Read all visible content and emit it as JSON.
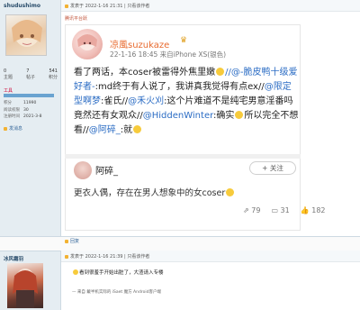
{
  "post1": {
    "username": "shudushimo",
    "stats": [
      {
        "value": "0",
        "label": ""
      },
      {
        "value": "7",
        "label": ""
      },
      {
        "value": "541",
        "label": ""
      },
      {
        "value": "主题",
        "label": ""
      },
      {
        "value": "帖子",
        "label": ""
      },
      {
        "value": "积分",
        "label": ""
      }
    ],
    "level_label": "工具",
    "info": [
      {
        "key": "积分",
        "val": "11990"
      },
      {
        "key": "阅读权限",
        "val": "30"
      },
      {
        "key": "注册时间",
        "val": "2021-3-8"
      }
    ],
    "msg_btn": "发消息",
    "header": "发表于 2022-1-16 21:31  |  只看该作者",
    "title_line": "腾讯平台跃",
    "card": {
      "user": "凉風suzukaze",
      "meta": "22-1-16 18:45 来自iPhone XS(银色)",
      "text_parts": [
        {
          "t": "看了两话，本coser被雷得外焦里嫩",
          "at": false
        },
        {
          "t": "//@-脆皮鸭十级爱好者-",
          "at": true
        },
        {
          "t": ":md终于有人说了，我讲真我觉得有点ex//",
          "at": false
        },
        {
          "t": "@限定型啊梦",
          "at": true
        },
        {
          "t": ":雀氏//",
          "at": false
        },
        {
          "t": "@禾火刈",
          "at": true
        },
        {
          "t": ":这个片难道不是纯宅男意淫番吗竟然还有女观众//",
          "at": false
        },
        {
          "t": "@HiddenWinter",
          "at": true
        },
        {
          "t": ":确实",
          "at": false
        },
        {
          "t": "所以完全不想看//",
          "at": false
        },
        {
          "t": "@阿碎_",
          "at": true
        },
        {
          "t": ":就",
          "at": false
        }
      ],
      "sub_user": "阿碎_",
      "follow": "+ 关注",
      "sub_text": "更衣人偶，存在在男人想象中的女coser",
      "actions": [
        {
          "icon": "share-icon",
          "count": "79"
        },
        {
          "icon": "comment-icon",
          "count": "31"
        },
        {
          "icon": "like-icon",
          "count": "182"
        }
      ]
    },
    "reply": "回复"
  },
  "post2": {
    "username": "冰风霜羽",
    "header": "发表于 2022-1-16 21:39  |  只看该作者",
    "text": "看到很羞手开始出脏了，大渣请入专楼",
    "signature": "— 来自 戴半机实际的 iSaet 魔方 Android客户端"
  }
}
